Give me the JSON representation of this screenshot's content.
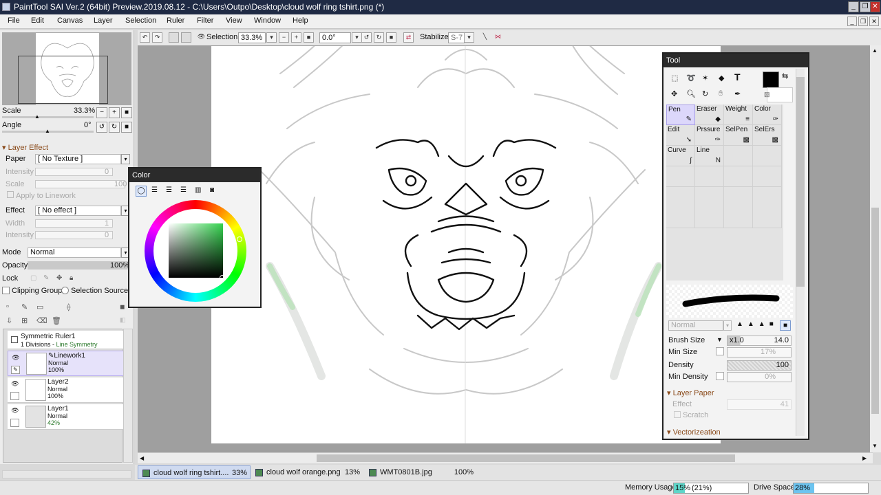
{
  "window": {
    "title": "PaintTool SAI Ver.2 (64bit) Preview.2019.08.12 - C:\\Users\\Outpo\\Desktop\\cloud wolf ring tshirt.png (*)"
  },
  "menu": [
    "File",
    "Edit",
    "Canvas",
    "Layer",
    "Selection",
    "Ruler",
    "Filter",
    "View",
    "Window",
    "Help"
  ],
  "toolbar": {
    "selection_label": "Selection",
    "zoom_value": "33.3%",
    "rotation_value": "0.0°",
    "stabilizer_label": "Stabilizer",
    "stabilizer_value": "S-7"
  },
  "navigator": {
    "scale_label": "Scale",
    "scale_value": "33.3%",
    "angle_label": "Angle",
    "angle_value": "0°"
  },
  "layer_effect": {
    "header": "Layer Effect",
    "paper_label": "Paper",
    "paper_value": "[ No Texture ]",
    "intensity_label": "Intensity",
    "intensity_value": "0",
    "scale_label": "Scale",
    "scale_value": "100",
    "apply_label": "Apply to Linework",
    "effect_label": "Effect",
    "effect_value": "[ No effect ]",
    "width_label": "Width",
    "width_value": "1",
    "intensity2_label": "Intensity",
    "intensity2_value": "0"
  },
  "layer_props": {
    "mode_label": "Mode",
    "mode_value": "Normal",
    "opacity_label": "Opacity",
    "opacity_value": "100%",
    "lock_label": "Lock",
    "clipping_label": "Clipping Group",
    "selection_source_label": "Selection Source"
  },
  "layers": [
    {
      "name": "Symmetric Ruler1",
      "line1": "1 Divisions - ",
      "line1b": "Line Symmetry",
      "line2": ""
    },
    {
      "name": "Linework1",
      "line1": "Normal",
      "line1b": "",
      "line2": "100%"
    },
    {
      "name": "Layer2",
      "line1": "Normal",
      "line1b": "",
      "line2": "100%"
    },
    {
      "name": "Layer1",
      "line1": "Normal",
      "line1b": "",
      "line2": "42%"
    }
  ],
  "color_panel": {
    "title": "Color",
    "selected_hex": "#0f3d12",
    "hue_hex": "#35d34f"
  },
  "tool_panel": {
    "title": "Tool",
    "main_color": "#000000",
    "tools": [
      {
        "label": "Pen",
        "icon": "pen-icon"
      },
      {
        "label": "Eraser",
        "icon": "eraser-icon"
      },
      {
        "label": "Weight",
        "icon": "weight-icon"
      },
      {
        "label": "Color",
        "icon": "color-icon"
      },
      {
        "label": "Edit",
        "icon": "edit-icon"
      },
      {
        "label": "Prssure",
        "icon": "pressure-icon"
      },
      {
        "label": "SelPen",
        "icon": "selpen-icon"
      },
      {
        "label": "SelErs",
        "icon": "selers-icon"
      },
      {
        "label": "Curve",
        "icon": "curve-icon"
      },
      {
        "label": "Line",
        "icon": "line-icon"
      }
    ],
    "blend_mode": "Normal",
    "brush_size_label": "Brush Size",
    "brush_size_mult": "x1.0",
    "brush_size_value": "14.0",
    "min_size_label": "Min Size",
    "min_size_value": "17%",
    "density_label": "Density",
    "density_value": "100",
    "min_density_label": "Min Density",
    "min_density_value": "0%",
    "layer_paper_label": "Layer Paper",
    "effect_label": "Effect",
    "effect_value": "41",
    "scratch_label": "Scratch",
    "vectorization_label": "Vectorizeation"
  },
  "documents": [
    {
      "name": "cloud wolf ring tshirt....",
      "zoom": "33%"
    },
    {
      "name": "cloud wolf orange.png",
      "zoom": "13%"
    },
    {
      "name": "WMT0801B.jpg",
      "zoom": "100%"
    }
  ],
  "status": {
    "memory_label": "Memory Usage",
    "memory_value": "15%",
    "memory_extra": "(21%)",
    "memory_percent": 15,
    "drive_label": "Drive Space",
    "drive_value": "28%",
    "drive_percent": 28
  }
}
